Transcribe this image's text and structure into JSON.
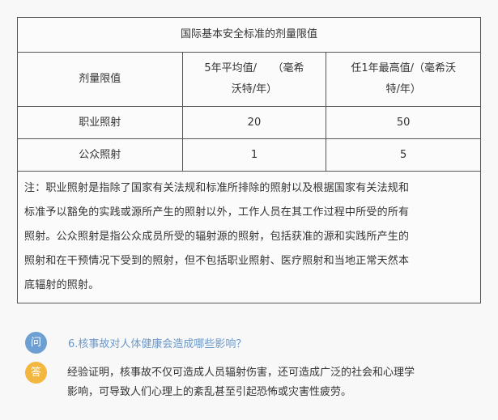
{
  "table": {
    "title": "国际基本安全标准的剂量限值",
    "col1_header": "剂量限值",
    "col2_header_line1": "5年平均值/　　（毫希",
    "col2_header_line2": "沃特/年）",
    "col3_header_line1": "任1年最高值/（毫希沃",
    "col3_header_line2": "特/年）",
    "rows": [
      {
        "label": "职业照射",
        "avg5": "20",
        "max1": "50"
      },
      {
        "label": "公众照射",
        "avg5": "1",
        "max1": "5"
      }
    ],
    "note_lines": [
      "注：职业照射是指除了国家有关法规和标准所排除的照射以及根据国家有关法规和",
      "标准予以豁免的实践或源所产生的照射以外，工作人员在其工作过程中所受的所有",
      "照射。公众照射是指公众成员所受的辐射源的照射，包括获准的源和实践所产生的",
      "照射和在干预情况下受到的照射，但不包括职业照射、医疗照射和当地正常天然本",
      "底辐射的照射。"
    ]
  },
  "qa": {
    "q_badge": "问",
    "question": "6.核事故对人体健康会造成哪些影响？",
    "a_badge": "答",
    "answer_lines": [
      "经验证明，核事故不仅可造成人员辐射伤害，还可造成广泛的社会和心理学",
      "影响，可导致人们心理上的紊乱甚至引起恐怖或灾害性疲劳。"
    ]
  },
  "colors": {
    "question_badge": "#6e9fd3",
    "answer_badge": "#f3b63f",
    "question_text": "#6a98c9"
  }
}
